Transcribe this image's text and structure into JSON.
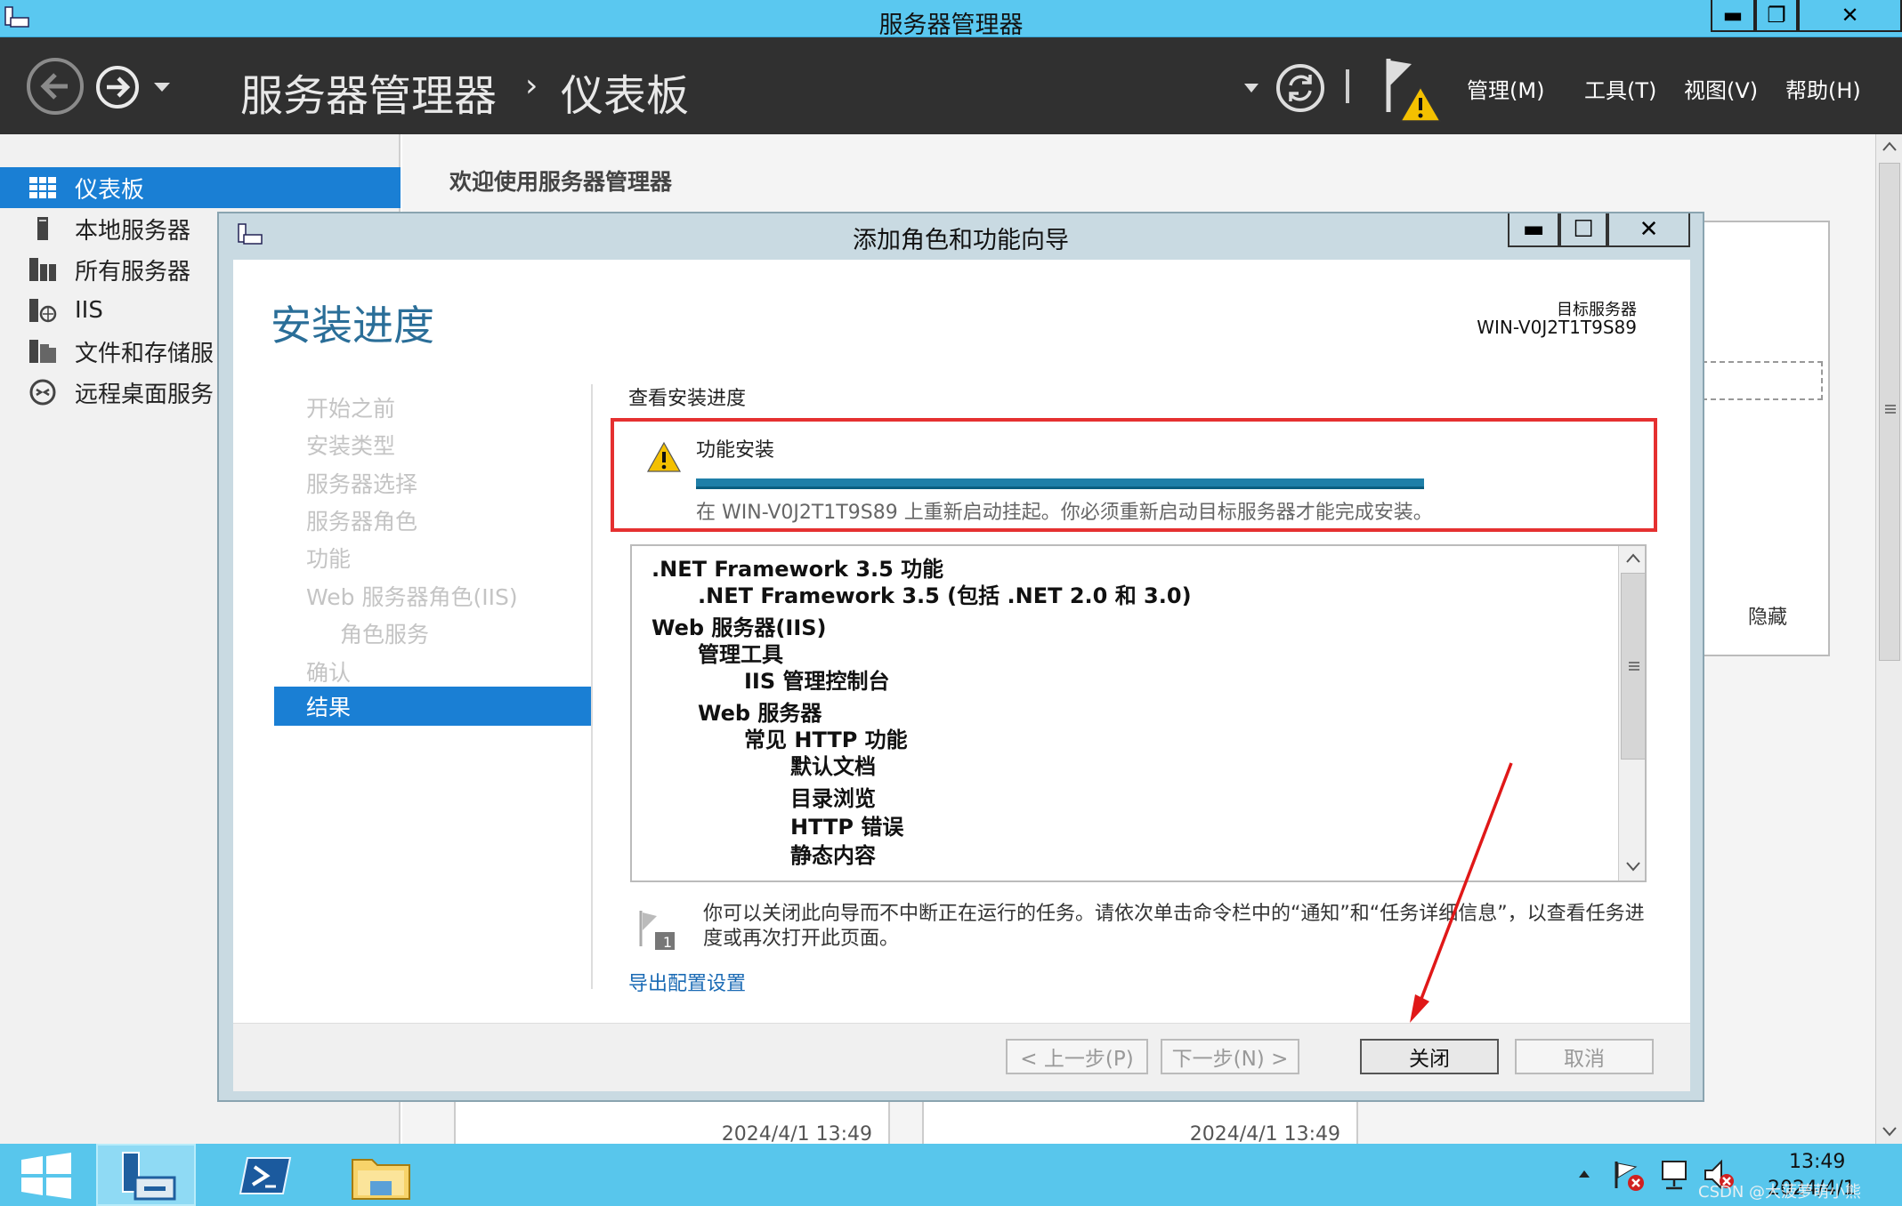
{
  "window": {
    "title": "服务器管理器",
    "minimize": "▬",
    "restore": "❐",
    "close": "✕"
  },
  "header": {
    "breadcrumb_root": "服务器管理器",
    "breadcrumb_sep": "›",
    "breadcrumb_current": "仪表板",
    "menu": [
      "管理(M)",
      "工具(T)",
      "视图(V)",
      "帮助(H)"
    ]
  },
  "sidebar": {
    "items": [
      {
        "label": "仪表板",
        "icon": "dashboard-icon"
      },
      {
        "label": "本地服务器",
        "icon": "server-icon"
      },
      {
        "label": "所有服务器",
        "icon": "servers-icon"
      },
      {
        "label": "IIS",
        "icon": "iis-icon"
      },
      {
        "label": "文件和存储服",
        "icon": "storage-icon"
      },
      {
        "label": "远程桌面服务",
        "icon": "remote-desktop-icon"
      }
    ]
  },
  "main": {
    "welcome": "欢迎使用服务器管理器",
    "hide_label": "隐藏",
    "timestamps": [
      "2024/4/1 13:49",
      "2024/4/1 13:49"
    ]
  },
  "dialog": {
    "title": "添加角色和功能向导",
    "heading": "安装进度",
    "target_label": "目标服务器",
    "target_server": "WIN-V0J2T1T9S89",
    "steps": [
      "开始之前",
      "安装类型",
      "服务器选择",
      "服务器角色",
      "功能",
      "Web 服务器角色(IIS)",
      "角色服务",
      "确认",
      "结果"
    ],
    "section_title": "查看安装进度",
    "status_title": "功能安装",
    "progress": 1.0,
    "status_message": "在 WIN-V0J2T1T9S89 上重新启动挂起。你必须重新启动目标服务器才能完成安装。",
    "features": [
      ".NET Framework 3.5 功能",
      ".NET Framework 3.5 (包括 .NET 2.0 和 3.0)",
      "Web 服务器(IIS)",
      "管理工具",
      "IIS 管理控制台",
      "Web 服务器",
      "常见 HTTP 功能",
      "默认文档",
      "目录浏览",
      "HTTP 错误",
      "静态内容"
    ],
    "note": "你可以关闭此向导而不中断正在运行的任务。请依次单击命令栏中的“通知”和“任务详细信息”，以查看任务进度或再次打开此页面。",
    "note_badge": "1",
    "export_link": "导出配置设置",
    "buttons": {
      "prev": "< 上一步(P)",
      "next": "下一步(N) >",
      "close": "关闭",
      "cancel": "取消"
    }
  },
  "taskbar": {
    "time": "13:49",
    "date": "2024/4/1",
    "watermark": "CSDN @大菠萝萌小熊"
  },
  "colors": {
    "accent": "#1a7fd4",
    "titlebar": "#5ac8f0",
    "header": "#303030",
    "highlight": "#e53030",
    "progress": "#1f7fa8"
  }
}
